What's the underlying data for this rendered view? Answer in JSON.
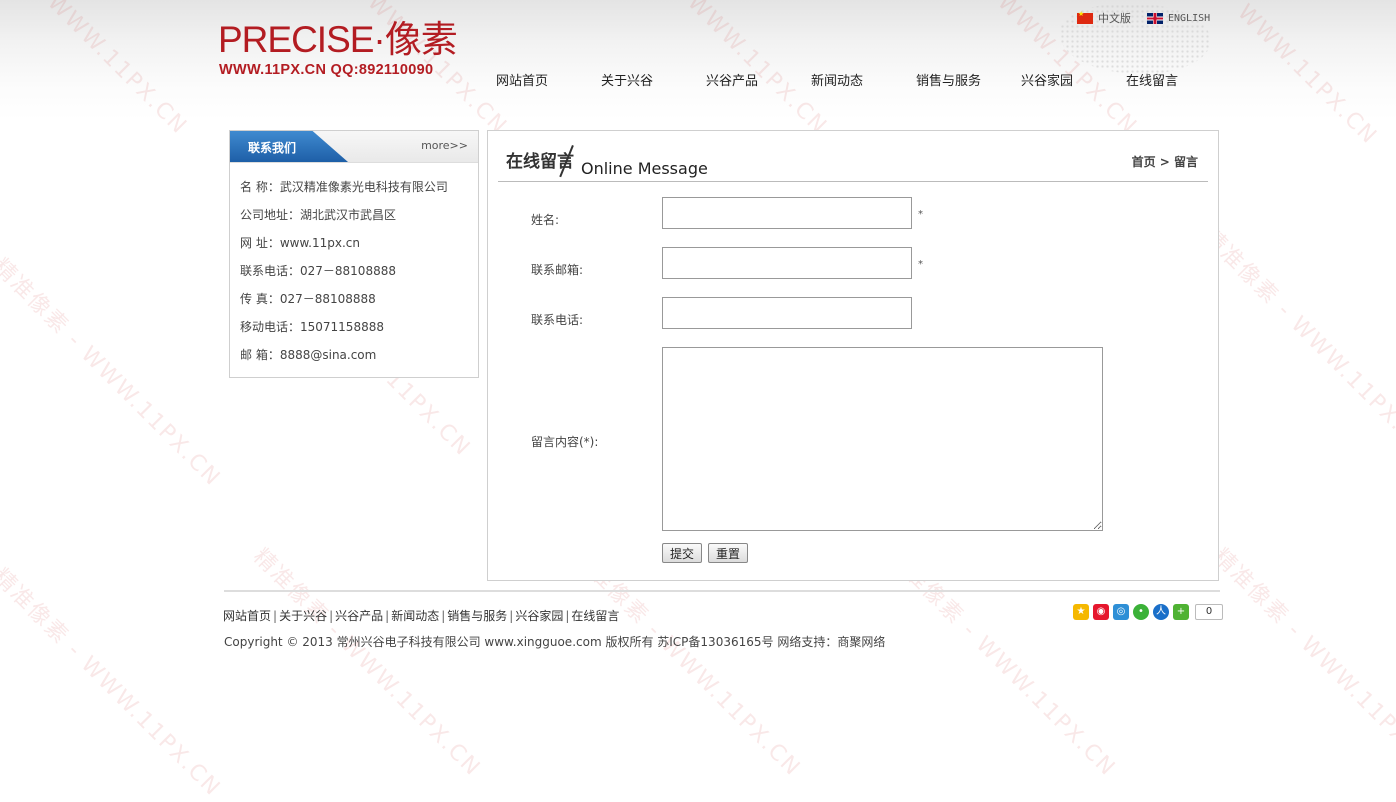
{
  "brand": {
    "logo_main": "PRECISE·像素",
    "logo_sub": "WWW.11PX.CN QQ:892110090"
  },
  "lang": {
    "cn": "中文版",
    "en": "ENGLISH"
  },
  "nav": {
    "items": [
      {
        "label": "网站首页"
      },
      {
        "label": "关于兴谷"
      },
      {
        "label": "兴谷产品"
      },
      {
        "label": "新闻动态"
      },
      {
        "label": "销售与服务"
      },
      {
        "label": "兴谷家园"
      },
      {
        "label": "在线留言"
      }
    ]
  },
  "sidebar": {
    "title": "联系我们",
    "more": "more>>",
    "items": [
      "名 称：武汉精准像素光电科技有限公司",
      "公司地址：湖北武汉市武昌区",
      "网 址：www.11px.cn",
      "联系电话：027－88108888",
      "传 真：027－88108888",
      "移动电话：15071158888",
      "邮 箱：8888@sina.com"
    ]
  },
  "main": {
    "title_cn": "在线留言",
    "title_en": "Online Message",
    "breadcrumb": "首页 > 留言",
    "form": {
      "name_label": "姓名:",
      "email_label": "联系邮箱:",
      "phone_label": "联系电话:",
      "content_label": "留言内容(*):",
      "required_mark": "*",
      "name_value": "",
      "email_value": "",
      "phone_value": "",
      "content_value": "",
      "submit": "提交",
      "reset": "重置"
    }
  },
  "footer": {
    "links": [
      "网站首页",
      "关于兴谷",
      "兴谷产品",
      "新闻动态",
      "销售与服务",
      "兴谷家园",
      "在线留言"
    ],
    "separator": "|",
    "copyright": "Copyright © 2013 常州兴谷电子科技有限公司 www.xingguoe.com 版权所有 苏ICP备13036165号 网络支持：商聚网络",
    "share_count": "0"
  },
  "watermark": {
    "cn": "精准像素",
    "url": "WWW.11PX.CN"
  },
  "colors": {
    "brand_red": "#b31c22",
    "tab_blue": "#1e5fa7"
  },
  "icons": [
    "qzone-icon",
    "weibo-icon",
    "tencent-weibo-icon",
    "wechat-icon",
    "renren-icon",
    "more-share-icon"
  ]
}
